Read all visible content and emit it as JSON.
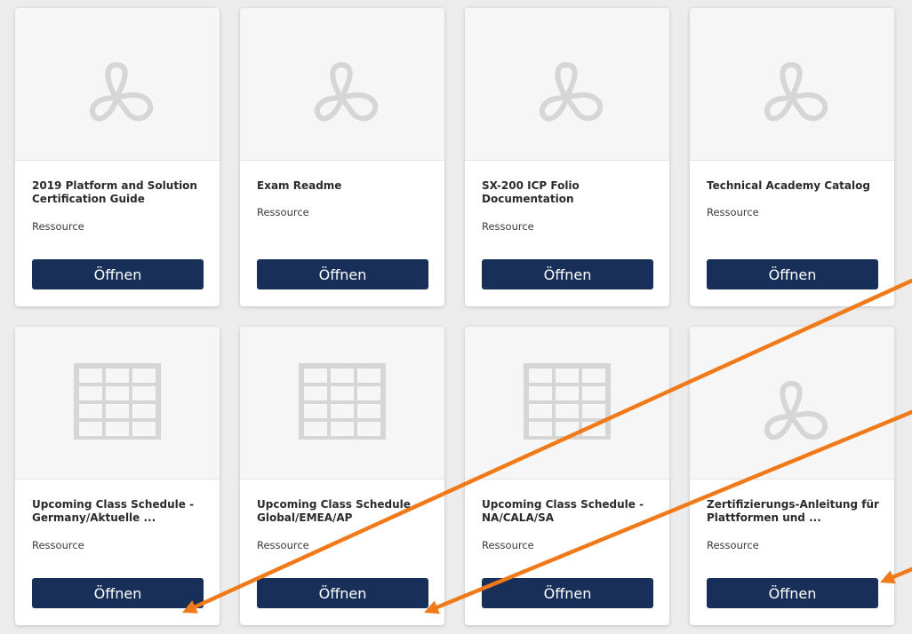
{
  "cards": [
    {
      "title": "2019 Platform and Solution Certification Guide",
      "subtitle": "Ressource",
      "icon": "pdf-icon",
      "button": "Öffnen"
    },
    {
      "title": "Exam Readme",
      "subtitle": "Ressource",
      "icon": "pdf-icon",
      "button": "Öffnen"
    },
    {
      "title": "SX-200 ICP Folio Documentation",
      "subtitle": "Ressource",
      "icon": "pdf-icon",
      "button": "Öffnen"
    },
    {
      "title": "Technical Academy Catalog",
      "subtitle": "Ressource",
      "icon": "pdf-icon",
      "button": "Öffnen"
    },
    {
      "title": "Upcoming Class Schedule - Germany/Aktuelle ...",
      "subtitle": "Ressource",
      "icon": "spreadsheet-icon",
      "button": "Öffnen"
    },
    {
      "title": "Upcoming Class Schedule - Global/EMEA/AP",
      "subtitle": "Ressource",
      "icon": "spreadsheet-icon",
      "button": "Öffnen"
    },
    {
      "title": "Upcoming Class Schedule - NA/CALA/SA",
      "subtitle": "Ressource",
      "icon": "spreadsheet-icon",
      "button": "Öffnen"
    },
    {
      "title": "Zertifizierungs-Anleitung für Plattformen und ...",
      "subtitle": "Ressource",
      "icon": "pdf-icon",
      "button": "Öffnen"
    }
  ],
  "colors": {
    "page_background": "#ececec",
    "button_background": "#182f5a",
    "annotation_arrow": "#f07a1a",
    "icon_gray": "#d6d6d6"
  }
}
